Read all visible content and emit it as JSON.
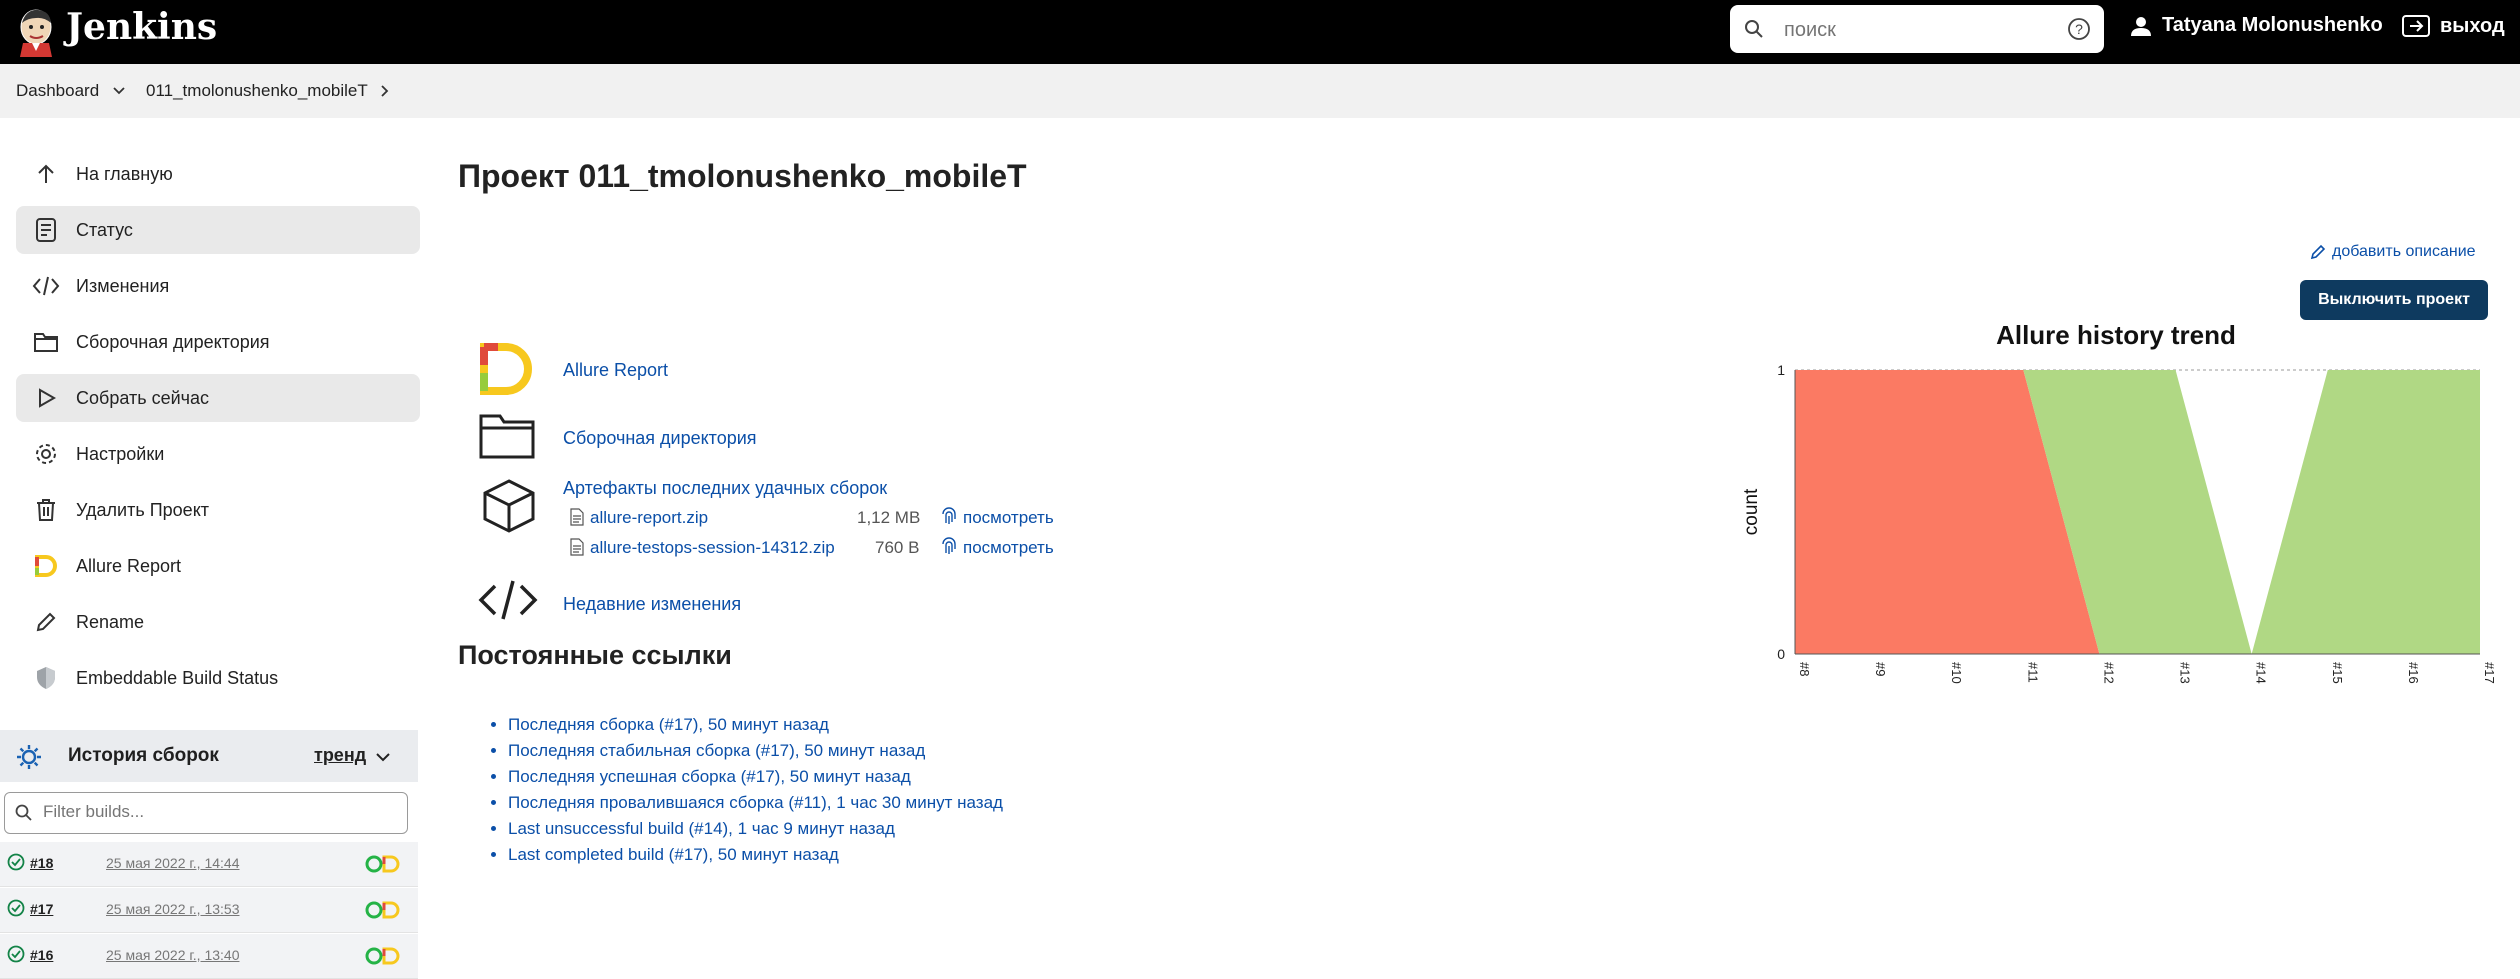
{
  "header": {
    "brand": "Jenkins",
    "search_placeholder": "поиск",
    "user_name": "Tatyana Molonushenko",
    "logout_label": "выход"
  },
  "breadcrumb": {
    "items": [
      "Dashboard",
      "011_tmolonushenko_mobileT"
    ]
  },
  "sidebar": {
    "items": [
      {
        "label": "На главную",
        "icon": "arrow-up-icon"
      },
      {
        "label": "Статус",
        "icon": "document-icon"
      },
      {
        "label": "Изменения",
        "icon": "code-icon"
      },
      {
        "label": "Сборочная директория",
        "icon": "folder-icon"
      },
      {
        "label": "Собрать сейчас",
        "icon": "play-icon"
      },
      {
        "label": "Настройки",
        "icon": "gear-icon"
      },
      {
        "label": "Удалить Проект",
        "icon": "trash-icon"
      },
      {
        "label": "Allure Report",
        "icon": "allure-icon"
      },
      {
        "label": "Rename",
        "icon": "pencil-icon"
      },
      {
        "label": "Embeddable Build Status",
        "icon": "shield-icon"
      }
    ],
    "history": {
      "title": "История сборок",
      "trend_label": "тренд",
      "filter_placeholder": "Filter builds..."
    },
    "builds": [
      {
        "number": "#18",
        "date": "25 мая 2022 г., 14:44"
      },
      {
        "number": "#17",
        "date": "25 мая 2022 г., 13:53"
      },
      {
        "number": "#16",
        "date": "25 мая 2022 г., 13:40"
      }
    ]
  },
  "main": {
    "title": "Проект 011_tmolonushenko_mobileT",
    "add_description": "добавить описание",
    "disable_button": "Выключить проект",
    "links": {
      "allure": "Allure Report",
      "workspace": "Сборочная директория",
      "artifacts_title": "Артефакты последних удачных сборок",
      "recent_changes": "Недавние изменения"
    },
    "artifacts": [
      {
        "name": "allure-report.zip",
        "size": "1,12 MB",
        "view": "посмотреть"
      },
      {
        "name": "allure-testops-session-14312.zip",
        "size": "760 B",
        "view": "посмотреть"
      }
    ],
    "permalinks_title": "Постоянные ссылки",
    "permalinks": [
      "Последняя сборка (#17), 50 минут назад",
      "Последняя стабильная сборка (#17), 50 минут назад",
      "Последняя успешная сборка (#17), 50 минут назад",
      "Последняя провалившаяся сборка (#11), 1 час 30 минут назад",
      "Last unsuccessful build (#14), 1 час 9 минут назад",
      "Last completed build (#17), 50 минут назад"
    ]
  },
  "colors": {
    "failed": "#fb7a63",
    "passed": "#b0d884",
    "header_bg": "#000000",
    "link": "#0b4fa8",
    "button": "#0e3a5f"
  },
  "chart_data": {
    "type": "area",
    "title": "Allure history trend",
    "xlabel": "",
    "ylabel": "count",
    "x": [
      "#8",
      "#9",
      "#10",
      "#11",
      "#12",
      "#13",
      "#14",
      "#15",
      "#16",
      "#17"
    ],
    "series": [
      {
        "name": "",
        "color": "failed",
        "values": [
          1,
          1,
          1,
          1,
          0,
          0,
          0,
          0,
          0,
          0
        ]
      },
      {
        "name": "",
        "color": "passed",
        "values": [
          0,
          0,
          0,
          0,
          1,
          1,
          0,
          1,
          1,
          1
        ]
      }
    ],
    "ylim": [
      0,
      1
    ],
    "yticks": [
      0,
      1
    ],
    "grid": false,
    "legend": "none"
  }
}
